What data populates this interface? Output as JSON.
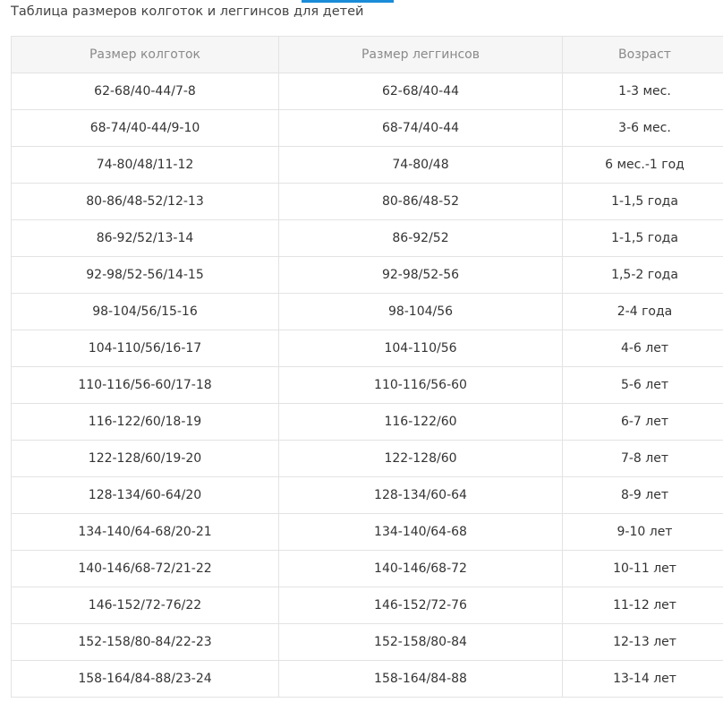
{
  "page": {
    "title": "Таблица размеров колготок и леггинсов для детей",
    "accent_color": "#1a8cd8"
  },
  "table": {
    "headers": [
      "Размер колготок",
      "Размер леггинсов",
      "Возраст"
    ],
    "rows": [
      [
        "62-68/40-44/7-8",
        "62-68/40-44",
        "1-3 мес."
      ],
      [
        "68-74/40-44/9-10",
        "68-74/40-44",
        "3-6 мес."
      ],
      [
        "74-80/48/11-12",
        "74-80/48",
        "6 мес.-1 год"
      ],
      [
        "80-86/48-52/12-13",
        "80-86/48-52",
        "1-1,5 года"
      ],
      [
        "86-92/52/13-14",
        "86-92/52",
        "1-1,5 года"
      ],
      [
        "92-98/52-56/14-15",
        "92-98/52-56",
        "1,5-2 года"
      ],
      [
        "98-104/56/15-16",
        "98-104/56",
        "2-4 года"
      ],
      [
        "104-110/56/16-17",
        "104-110/56",
        "4-6 лет"
      ],
      [
        "110-116/56-60/17-18",
        "110-116/56-60",
        "5-6 лет"
      ],
      [
        "116-122/60/18-19",
        "116-122/60",
        "6-7 лет"
      ],
      [
        "122-128/60/19-20",
        "122-128/60",
        "7-8 лет"
      ],
      [
        "128-134/60-64/20",
        "128-134/60-64",
        "8-9 лет"
      ],
      [
        "134-140/64-68/20-21",
        "134-140/64-68",
        "9-10 лет"
      ],
      [
        "140-146/68-72/21-22",
        "140-146/68-72",
        "10-11 лет"
      ],
      [
        "146-152/72-76/22",
        "146-152/72-76",
        "11-12 лет"
      ],
      [
        "152-158/80-84/22-23",
        "152-158/80-84",
        "12-13 лет"
      ],
      [
        "158-164/84-88/23-24",
        "158-164/84-88",
        "13-14 лет"
      ]
    ]
  }
}
